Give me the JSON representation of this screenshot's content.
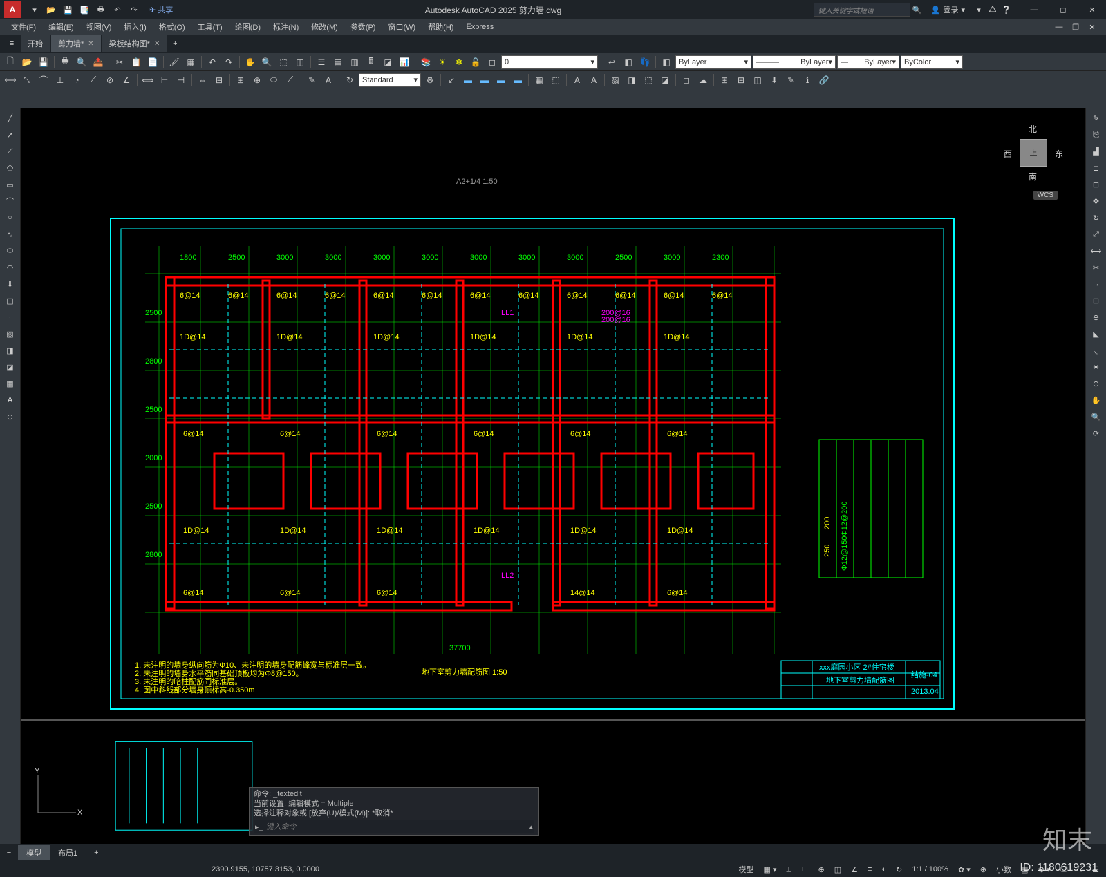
{
  "app": {
    "icon": "A",
    "title": "Autodesk AutoCAD 2025   剪力墙.dwg",
    "share": "共享",
    "search_placeholder": "键入关键字或短语",
    "login": "登录"
  },
  "menubar": [
    "文件(F)",
    "编辑(E)",
    "视图(V)",
    "插入(I)",
    "格式(O)",
    "工具(T)",
    "绘图(D)",
    "标注(N)",
    "修改(M)",
    "参数(P)",
    "窗口(W)",
    "帮助(H)",
    "Express"
  ],
  "tabs": {
    "items": [
      {
        "label": "开始"
      },
      {
        "label": "剪力墙*",
        "active": true
      },
      {
        "label": "梁板结构图*"
      }
    ],
    "add": "+"
  },
  "props": {
    "layer": "0",
    "linetype": "ByLayer",
    "lineweight": "ByLayer",
    "color": "ByLayer",
    "plotstyle": "ByColor",
    "textstyle": "Standard"
  },
  "viewcube": {
    "top": "上",
    "n": "北",
    "s": "南",
    "e": "东",
    "w": "西",
    "wcs": "WCS"
  },
  "drawing": {
    "title": "A2+1/4 1:50",
    "plan_title": "地下室剪力墙配筋图 1:50",
    "rebar_label": "6@14",
    "notes": [
      "1. 未注明的墙身纵向筋为Φ10、未注明的墙身配筋峰宽与标准层一致。",
      "2. 未注明的墙身水平筋同基础顶板均为Φ8@150。",
      "3. 未注明的暗柱配筋同标准层。",
      "4. 图中斜线部分墙身顶标高-0.350m"
    ],
    "titleblock": {
      "project": "xxx庭园小区   2#住宅楼",
      "drawing": "地下室剪力墙配筋图",
      "sheet": "结施-04",
      "date": "2013.04"
    }
  },
  "cmd": {
    "l1": "命令: _textedit",
    "l2": "当前设置: 编辑模式 = Multiple",
    "l3": "选择注释对象或 [放弃(U)/模式(M)]: *取消*",
    "prompt": "键入命令"
  },
  "layout_tabs": {
    "model": "模型",
    "layout1": "布局1",
    "add": "+"
  },
  "status": {
    "coords": "2390.9155, 10757.3153, 0.0000",
    "model": "模型",
    "grid": "▦",
    "zoom": "1:1 / 100%",
    "dec": "小数",
    "gear": "✿"
  },
  "axis": {
    "x": "X",
    "y": "Y"
  },
  "watermark": "知末",
  "id": "ID: 1180619231"
}
